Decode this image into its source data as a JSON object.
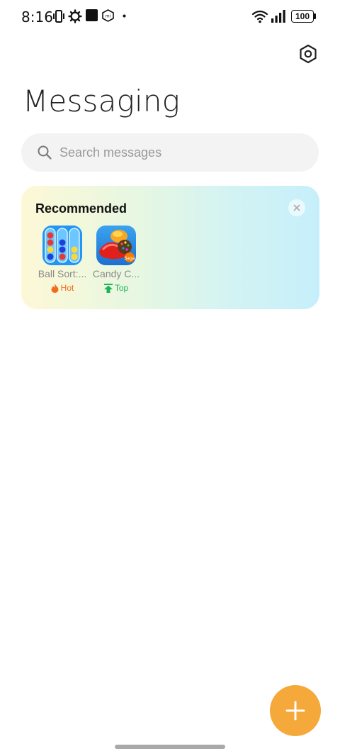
{
  "status_bar": {
    "time": "8:16",
    "battery": "100",
    "icons": [
      "vibrate-icon",
      "settings-gear-icon",
      "square-app-icon",
      "mi-icon",
      "dot-icon",
      "wifi-icon",
      "signal-icon",
      "battery-icon"
    ]
  },
  "header": {
    "title": "Messaging",
    "settings_icon": "hexagon-settings-icon"
  },
  "search": {
    "placeholder": "Search messages",
    "value": ""
  },
  "recommended": {
    "title": "Recommended",
    "apps": [
      {
        "name": "Ball Sort:...",
        "badge": "Hot",
        "badge_icon": "flame-icon",
        "badge_color": "#f26b1d"
      },
      {
        "name": "Candy C...",
        "badge": "Top",
        "badge_icon": "up-arrow-icon",
        "badge_color": "#20b25b"
      }
    ]
  },
  "fab": {
    "icon": "plus-icon",
    "color": "#f5a93a"
  }
}
